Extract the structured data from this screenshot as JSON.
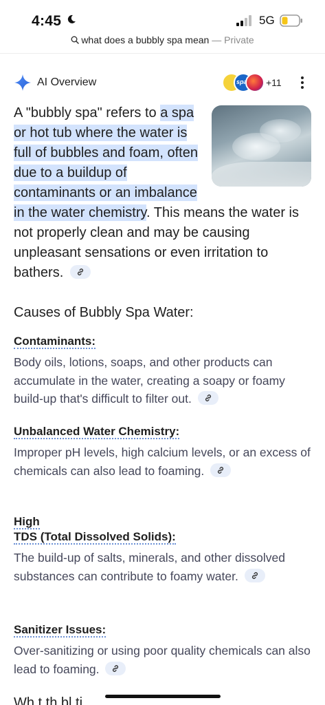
{
  "status_bar": {
    "time": "4:45",
    "network": "5G"
  },
  "url_bar": {
    "query": "what does a bubbly spa mean",
    "separator": "—",
    "mode": "Private"
  },
  "ai_overview": {
    "title": "AI Overview",
    "source_count": "+11",
    "fav2_text": "spa",
    "accent_color": "#4285f4",
    "highlight_color": "#d3e3fd"
  },
  "summary": {
    "intro": "A \"bubbly spa\" refers to ",
    "highlight": "a spa or hot tub where the water is full of bubbles and foam, often due to a buildup of contaminants or an imbalance in the water chemistry",
    "rest": ". This means the water is not properly clean and may be causing unpleasant sensations or even irritation to bathers."
  },
  "causes": {
    "heading": "Causes of Bubbly Spa Water:",
    "items": [
      {
        "title": "Contaminants:",
        "body": "Body oils, lotions, soaps, and other products can accumulate in the water, creating a soapy or foamy build-up that's difficult to filter out."
      },
      {
        "title": "Unbalanced Water Chemistry:",
        "body": "Improper pH levels, high calcium levels, or an excess of chemicals can also lead to foaming."
      },
      {
        "title_line1": "High",
        "title_line2": "TDS (Total Dissolved Solids):",
        "body": "The build-up of salts, minerals, and other dissolved substances can contribute to foamy water."
      },
      {
        "title": "Sanitizer Issues:",
        "body": "Over-sanitizing or using poor quality chemicals can also lead to foaming."
      }
    ]
  },
  "next_heading": "Wh t th    bl     ti"
}
